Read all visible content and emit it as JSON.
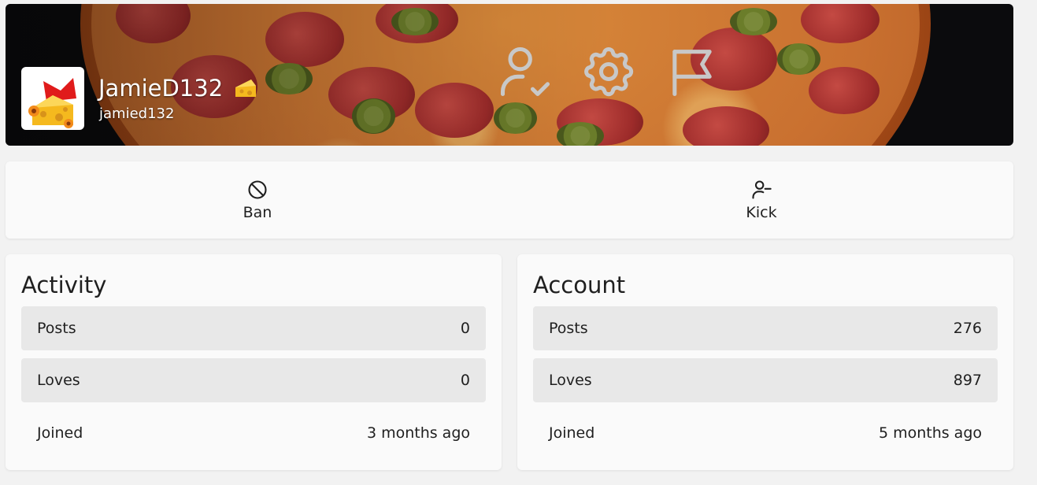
{
  "profile": {
    "display_name": "JamieD132",
    "username": "jamied132",
    "badge_icon": "cheese-icon",
    "avatar_icon": "cheese-avatar-icon"
  },
  "banner_actions": [
    {
      "name": "follow",
      "icon": "user-check-icon"
    },
    {
      "name": "settings",
      "icon": "gear-icon"
    },
    {
      "name": "report",
      "icon": "flag-icon"
    }
  ],
  "actions": {
    "ban_label": "Ban",
    "kick_label": "Kick"
  },
  "activity": {
    "title": "Activity",
    "posts_label": "Posts",
    "posts_value": "0",
    "loves_label": "Loves",
    "loves_value": "0",
    "joined_label": "Joined",
    "joined_value": "3 months ago"
  },
  "account": {
    "title": "Account",
    "posts_label": "Posts",
    "posts_value": "276",
    "loves_label": "Loves",
    "loves_value": "897",
    "joined_label": "Joined",
    "joined_value": "5 months ago"
  },
  "colors": {
    "page_bg": "#f2f2f2",
    "card_bg": "#fafafa",
    "row_shade": "#e8e8e8",
    "banner_icon": "#c8c8c8"
  }
}
